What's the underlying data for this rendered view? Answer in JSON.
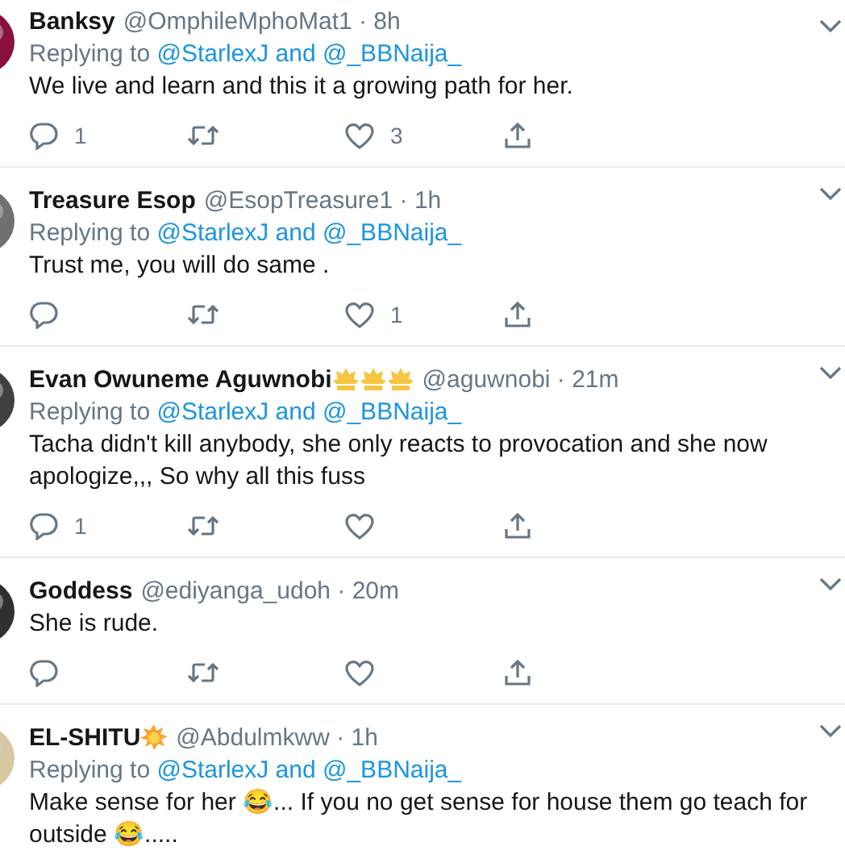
{
  "tweets": [
    {
      "name": "Banksy",
      "meta": "@OmphileMphoMat1 · 8h",
      "replying_prefix": "Replying to",
      "replying_users": "@StarlexJ and @_BBNaija_",
      "text": "We live and learn and this it a growing path for her.",
      "actions": [
        {
          "kind": "reply",
          "count": "1"
        },
        {
          "kind": "retweet"
        },
        {
          "kind": "like",
          "count": "3"
        },
        {
          "kind": "share"
        }
      ]
    },
    {
      "name": "Treasure Esop",
      "meta": "@EsopTreasure1 · 1h",
      "replying_prefix": "Replying to",
      "replying_users": "@StarlexJ and @_BBNaija_",
      "text": "Trust me, you will do same .",
      "actions": [
        {
          "kind": "reply"
        },
        {
          "kind": "retweet"
        },
        {
          "kind": "like",
          "count": "1"
        },
        {
          "kind": "share"
        }
      ]
    },
    {
      "name": "Evan Owuneme Aguwnobi",
      "badges": [
        {
          "kind": "crown"
        },
        {
          "kind": "crown"
        },
        {
          "kind": "crown"
        }
      ],
      "meta": "@aguwnobi · 21m",
      "replying_prefix": "Replying to",
      "replying_users": "@StarlexJ and @_BBNaija_",
      "text": "Tacha didn't kill anybody, she  only reacts to provocation and she now apologize,,, So why all this  fuss",
      "actions": [
        {
          "kind": "reply",
          "count": "1"
        },
        {
          "kind": "retweet"
        },
        {
          "kind": "like"
        },
        {
          "kind": "share"
        }
      ]
    },
    {
      "name": "Goddess",
      "meta": "@ediyanga_udoh · 20m",
      "text": "She is rude.",
      "actions": [
        {
          "kind": "reply"
        },
        {
          "kind": "retweet"
        },
        {
          "kind": "like"
        },
        {
          "kind": "share"
        }
      ]
    },
    {
      "name": "EL-SHITU",
      "badges": [
        {
          "kind": "sun"
        }
      ],
      "meta": "@Abdulmkww · 1h",
      "replying_prefix": "Replying to",
      "replying_users": "@StarlexJ and @_BBNaija_",
      "text": "Make sense for her 😂... If you no get sense for house them go teach for outside 😂....."
    }
  ]
}
